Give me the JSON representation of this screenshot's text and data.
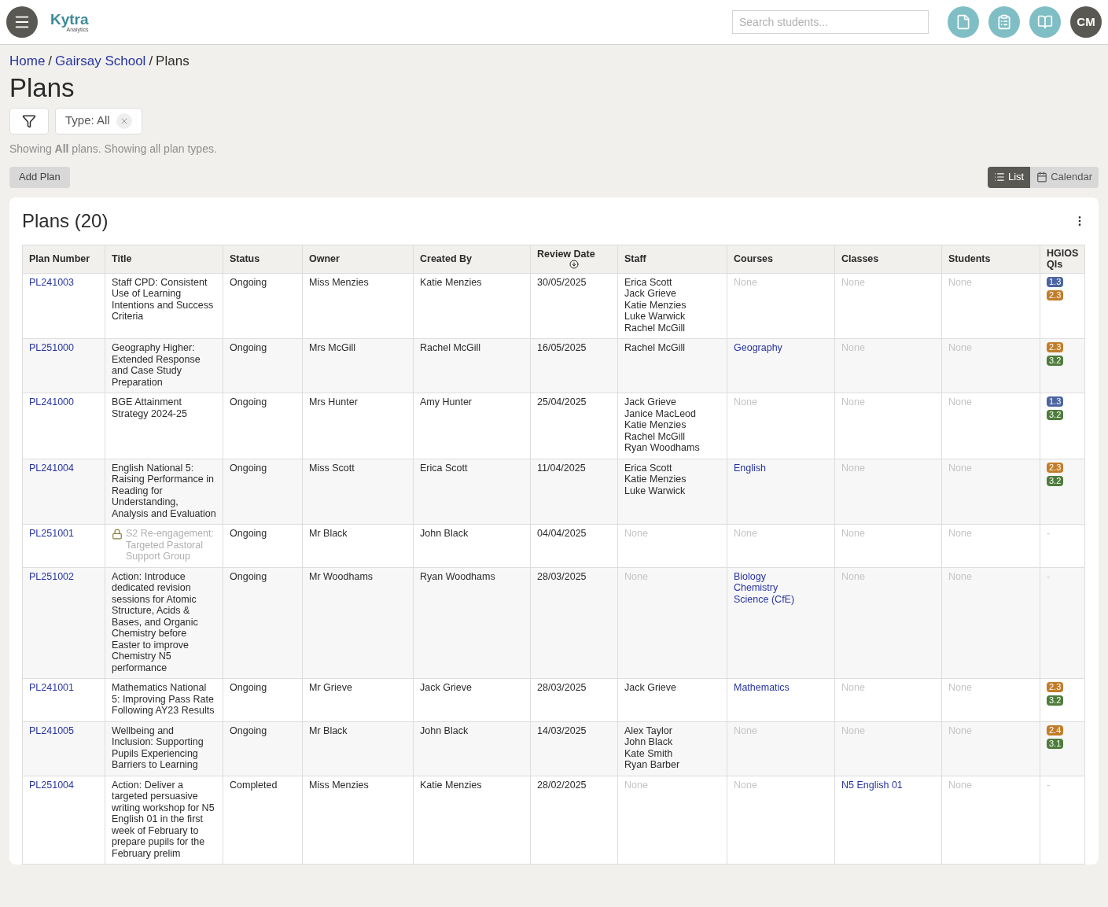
{
  "header": {
    "logo": {
      "name": "Kytra",
      "subtitle": "Analytics"
    },
    "search": {
      "placeholder": "Search students..."
    },
    "avatar": "CM"
  },
  "breadcrumb": [
    {
      "kind": "link",
      "label": "Home"
    },
    {
      "kind": "separator",
      "label": "/"
    },
    {
      "kind": "link",
      "label": "Gairsay School"
    },
    {
      "kind": "separator",
      "label": "/"
    },
    {
      "kind": "current",
      "label": "Plans"
    }
  ],
  "page_title": "Plans",
  "filters": [
    {
      "label": "Type: All"
    }
  ],
  "summary": "Showing **All** plans. Showing all plan types.",
  "add_button": "Add Plan",
  "view_toggle": [
    {
      "label": "List",
      "selected": true
    },
    {
      "label": "Calendar",
      "selected": false
    }
  ],
  "card": {
    "title": "Plans (20)"
  },
  "table": {
    "columns": [
      {
        "label": "Plan Number",
        "sorted": false
      },
      {
        "label": "Title",
        "sorted": false
      },
      {
        "label": "Status",
        "sorted": false
      },
      {
        "label": "Owner",
        "sorted": false
      },
      {
        "label": "Created By",
        "sorted": false
      },
      {
        "label": "Review Date",
        "sorted": true
      },
      {
        "label": "Staff",
        "sorted": false
      },
      {
        "label": "Courses",
        "sorted": false
      },
      {
        "label": "Classes",
        "sorted": false
      },
      {
        "label": "Students",
        "sorted": false
      },
      {
        "label": "HGIOS QIs",
        "sorted": false
      }
    ],
    "rows": [
      {
        "plan_number": "PL241003",
        "title": "Staff CPD: Consistent Use of Learning Intentions and Success Criteria",
        "locked": false,
        "status": "Ongoing",
        "owner": "Miss Menzies",
        "created_by": "Katie Menzies",
        "review_date": "30/05/2025",
        "staff": [
          "Erica Scott",
          "Jack Grieve",
          "Katie Menzies",
          "Luke Warwick",
          "Rachel McGill"
        ],
        "courses": "None",
        "classes": "None",
        "students": "None",
        "qis": [
          {
            "label": "1.3",
            "color": "#4a65a0"
          },
          {
            "label": "2.3",
            "color": "#c27d2a"
          }
        ]
      },
      {
        "plan_number": "PL251000",
        "title": "Geography Higher: Extended Response and Case Study Preparation",
        "locked": false,
        "status": "Ongoing",
        "owner": "Mrs McGill",
        "created_by": "Rachel McGill",
        "review_date": "16/05/2025",
        "staff": [
          "Rachel McGill"
        ],
        "courses": [
          "Geography"
        ],
        "classes": "None",
        "students": "None",
        "qis": [
          {
            "label": "2.3",
            "color": "#c27d2a"
          },
          {
            "label": "3.2",
            "color": "#4e7c3c"
          }
        ]
      },
      {
        "plan_number": "PL241000",
        "title": "BGE Attainment Strategy 2024-25",
        "locked": false,
        "status": "Ongoing",
        "owner": "Mrs Hunter",
        "created_by": "Amy Hunter",
        "review_date": "25/04/2025",
        "staff": [
          "Jack Grieve",
          "Janice MacLeod",
          "Katie Menzies",
          "Rachel McGill",
          "Ryan Woodhams"
        ],
        "courses": "None",
        "classes": "None",
        "students": "None",
        "qis": [
          {
            "label": "1.3",
            "color": "#4a65a0"
          },
          {
            "label": "3.2",
            "color": "#4e7c3c"
          }
        ]
      },
      {
        "plan_number": "PL241004",
        "title": "English National 5: Raising Performance in Reading for Understanding, Analysis and Evaluation",
        "locked": false,
        "status": "Ongoing",
        "owner": "Miss Scott",
        "created_by": "Erica Scott",
        "review_date": "11/04/2025",
        "staff": [
          "Erica Scott",
          "Katie Menzies",
          "Luke Warwick"
        ],
        "courses": [
          "English"
        ],
        "classes": "None",
        "students": "None",
        "qis": [
          {
            "label": "2.3",
            "color": "#c27d2a"
          },
          {
            "label": "3.2",
            "color": "#4e7c3c"
          }
        ]
      },
      {
        "plan_number": "PL251001",
        "title": "S2 Re-engagement: Targeted Pastoral Support Group",
        "locked": true,
        "status": "Ongoing",
        "owner": "Mr Black",
        "created_by": "John Black",
        "review_date": "04/04/2025",
        "staff": "None",
        "courses": "None",
        "classes": "None",
        "students": "None",
        "qis": "-"
      },
      {
        "plan_number": "PL251002",
        "title": "Action: Introduce dedicated revision sessions for Atomic Structure, Acids & Bases, and Organic Chemistry before Easter to improve Chemistry N5 performance",
        "locked": false,
        "status": "Ongoing",
        "owner": "Mr Woodhams",
        "created_by": "Ryan Woodhams",
        "review_date": "28/03/2025",
        "staff": "None",
        "courses": [
          "Biology",
          "Chemistry",
          "Science (CfE)"
        ],
        "classes": "None",
        "students": "None",
        "qis": "-"
      },
      {
        "plan_number": "PL241001",
        "title": "Mathematics National 5: Improving Pass Rate Following AY23 Results",
        "locked": false,
        "status": "Ongoing",
        "owner": "Mr Grieve",
        "created_by": "Jack Grieve",
        "review_date": "28/03/2025",
        "staff": [
          "Jack Grieve"
        ],
        "courses": [
          "Mathematics"
        ],
        "classes": "None",
        "students": "None",
        "qis": [
          {
            "label": "2.3",
            "color": "#c27d2a"
          },
          {
            "label": "3.2",
            "color": "#4e7c3c"
          }
        ]
      },
      {
        "plan_number": "PL241005",
        "title": "Wellbeing and Inclusion: Supporting Pupils Experiencing Barriers to Learning",
        "locked": false,
        "status": "Ongoing",
        "owner": "Mr Black",
        "created_by": "John Black",
        "review_date": "14/03/2025",
        "staff": [
          "Alex Taylor",
          "John Black",
          "Kate Smith",
          "Ryan Barber"
        ],
        "courses": "None",
        "classes": "None",
        "students": "None",
        "qis": [
          {
            "label": "2.4",
            "color": "#c27d2a"
          },
          {
            "label": "3.1",
            "color": "#4e7c3c"
          }
        ]
      },
      {
        "plan_number": "PL251004",
        "title": "Action: Deliver a targeted persuasive writing workshop for N5 English 01 in the first week of February to prepare pupils for the February prelim",
        "locked": false,
        "status": "Completed",
        "owner": "Miss Menzies",
        "created_by": "Katie Menzies",
        "review_date": "28/02/2025",
        "staff": "None",
        "courses": "None",
        "classes": [
          "N5 English 01"
        ],
        "students": "None",
        "qis": "-"
      }
    ]
  }
}
